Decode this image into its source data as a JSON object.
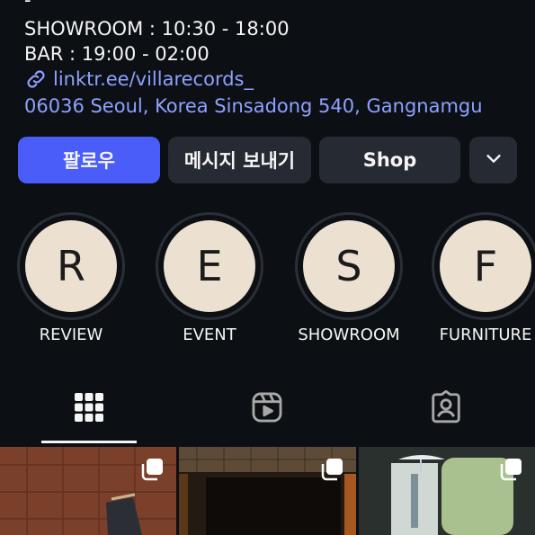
{
  "bio": {
    "dash": "-",
    "showroom_hours": "SHOWROOM : 10:30 - 18:00",
    "bar_hours": "BAR : 19:00 - 02:00",
    "link": "linktr.ee/villarecords_",
    "address": "06036 Seoul, Korea Sinsadong 540, Gangnamgu"
  },
  "actions": {
    "follow_label": "팔로우",
    "message_label": "메시지 보내기",
    "shop_label": "Shop",
    "more_icon": "chevron-down-icon"
  },
  "highlights": [
    {
      "letter": "R",
      "label": "REVIEW"
    },
    {
      "letter": "E",
      "label": "EVENT"
    },
    {
      "letter": "S",
      "label": "SHOWROOM"
    },
    {
      "letter": "F",
      "label": "FURNITURE"
    }
  ],
  "tabs": [
    {
      "icon": "grid-icon",
      "active": true
    },
    {
      "icon": "reels-icon",
      "active": false
    },
    {
      "icon": "tagged-icon",
      "active": false
    }
  ],
  "colors": {
    "background": "#0c1014",
    "accent": "#4a5df9",
    "link": "#8ea1ff",
    "button_secondary": "#262b33",
    "highlight_fill": "#ece0d1"
  }
}
